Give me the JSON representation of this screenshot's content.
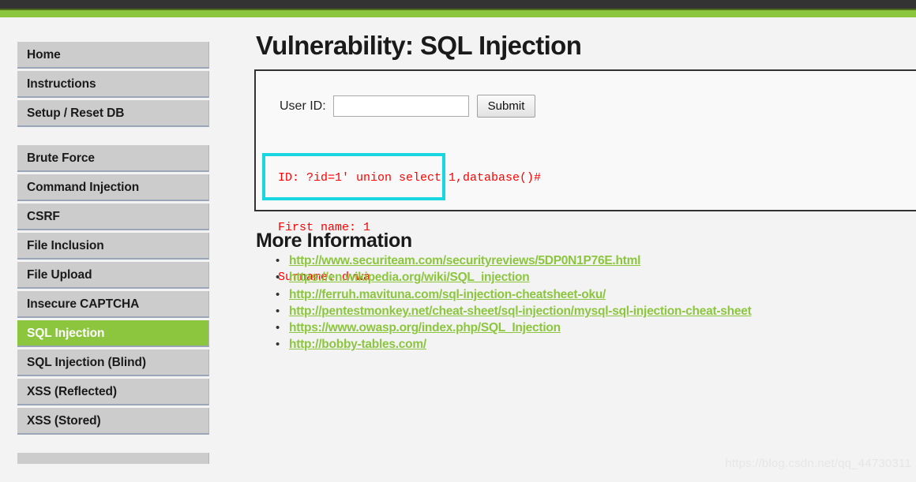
{
  "theme": {
    "topbar_color": "#333333",
    "accent_green": "#8cc63e",
    "page_background": "#f3f3f3",
    "nav_button_color": "#cccccc",
    "error_text_color": "#ff0000",
    "highlight_border_color": "#1ad6e0"
  },
  "sidebar": {
    "groups": [
      {
        "items": [
          {
            "label": "Home",
            "active": false
          },
          {
            "label": "Instructions",
            "active": false
          },
          {
            "label": "Setup / Reset DB",
            "active": false
          }
        ]
      },
      {
        "items": [
          {
            "label": "Brute Force",
            "active": false
          },
          {
            "label": "Command Injection",
            "active": false
          },
          {
            "label": "CSRF",
            "active": false
          },
          {
            "label": "File Inclusion",
            "active": false
          },
          {
            "label": "File Upload",
            "active": false
          },
          {
            "label": "Insecure CAPTCHA",
            "active": false
          },
          {
            "label": "SQL Injection",
            "active": true
          },
          {
            "label": "SQL Injection (Blind)",
            "active": false
          },
          {
            "label": "XSS (Reflected)",
            "active": false
          },
          {
            "label": "XSS (Stored)",
            "active": false
          }
        ]
      }
    ]
  },
  "main": {
    "page_title": "Vulnerability: SQL Injection",
    "form": {
      "user_id_label": "User ID:",
      "user_id_value": "",
      "user_id_placeholder": "",
      "submit_label": "Submit"
    },
    "result": {
      "id_line": "ID: ?id=1' union select 1,database()#",
      "first_name_line": "First name: 1",
      "surname_line": "Surname: dvwa"
    },
    "more_information": {
      "heading": "More Information",
      "links": [
        "http://www.securiteam.com/securityreviews/5DP0N1P76E.html",
        "https://en.wikipedia.org/wiki/SQL_injection",
        "http://ferruh.mavituna.com/sql-injection-cheatsheet-oku/",
        "http://pentestmonkey.net/cheat-sheet/sql-injection/mysql-sql-injection-cheat-sheet",
        "https://www.owasp.org/index.php/SQL_Injection",
        "http://bobby-tables.com/"
      ]
    }
  },
  "watermark": "https://blog.csdn.net/qq_44730311"
}
